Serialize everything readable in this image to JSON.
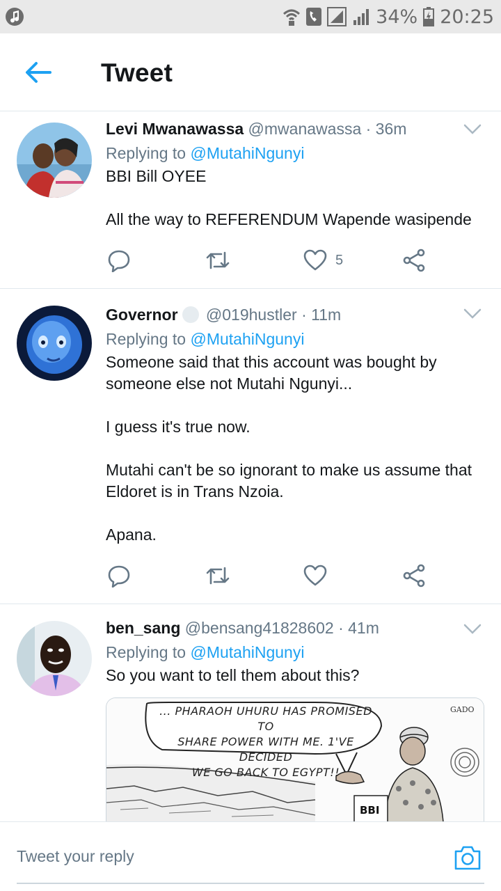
{
  "status_bar": {
    "battery": "34%",
    "time": "20:25",
    "icons": [
      "music-note-icon",
      "wifi-call-icon",
      "phone-icon",
      "signal-icon",
      "signal-icon",
      "battery-icon"
    ]
  },
  "header": {
    "title": "Tweet",
    "back_icon": "arrow-left-icon"
  },
  "tweets": [
    {
      "name": "Levi Mwanawassa",
      "handle": "@mwanawassa",
      "time": "· 36m",
      "reply_prefix": "Replying to",
      "reply_to": "@MutahiNgunyi",
      "paragraphs": [
        "BBI Bill OYEE",
        "All the way to REFERENDUM Wapende wasipende"
      ],
      "like_count": "5"
    },
    {
      "name": "Governor",
      "handle": "@019hustler",
      "time": "· 11m",
      "reply_prefix": "Replying to",
      "reply_to": "@MutahiNgunyi",
      "paragraphs": [
        "Someone said that this account was bought by someone else not Mutahi Ngunyi...",
        "I guess it's true now.",
        "Mutahi can't be so ignorant to make us assume that Eldoret is in Trans Nzoia.",
        "Apana."
      ],
      "like_count": ""
    },
    {
      "name": "ben_sang",
      "handle": "@bensang41828602",
      "time": "· 41m",
      "reply_prefix": "Replying to",
      "reply_to": "@MutahiNgunyi",
      "paragraphs": [
        "So you want to tell them about this?"
      ],
      "image": {
        "bubble_line1": "... PHARAOH UHURU HAS PROMISED TO",
        "bubble_line2": "SHARE POWER WITH ME. 1'VE DECIDED",
        "bubble_line3": "WE GO BACK TO EGYPT!!",
        "label": "BBI",
        "signature": "GADO"
      }
    }
  ],
  "reply_bar": {
    "placeholder": "Tweet your reply",
    "camera_icon": "camera-icon"
  },
  "colors": {
    "accent": "#1da1f2",
    "secondary_text": "#657786",
    "divider": "#e1e8ed"
  }
}
